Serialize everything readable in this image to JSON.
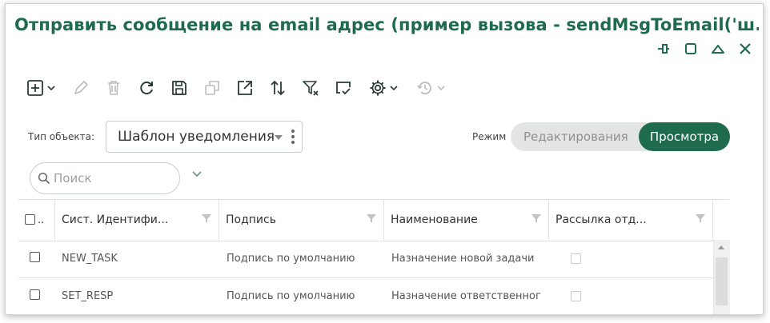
{
  "window": {
    "title": "Отправить сообщение на email адрес (пример вызова - sendMsgToEmail('ш...",
    "controls": [
      "pin-icon",
      "maximize-icon",
      "collapse-icon",
      "close-icon"
    ]
  },
  "toolbar": {
    "buttons": [
      "add-icon",
      "edit-icon",
      "delete-icon",
      "refresh-icon",
      "save-icon",
      "copy-icon",
      "open-external-icon",
      "sort-icon",
      "clear-filter-icon",
      "export-icon",
      "settings-icon",
      "history-icon"
    ]
  },
  "filter": {
    "object_type_label": "Тип объекта:",
    "object_type_value": "Шаблон уведомления",
    "mode_label": "Режим",
    "mode_edit": "Редактирования",
    "mode_view": "Просмотра",
    "active_mode": "Просмотра"
  },
  "search": {
    "placeholder": "Поиск",
    "value": ""
  },
  "table": {
    "columns": [
      {
        "label": "Сист. Идентифи..."
      },
      {
        "label": "Подпись"
      },
      {
        "label": "Наименование"
      },
      {
        "label": "Рассылка отд..."
      }
    ],
    "rows": [
      {
        "id": "NEW_TASK",
        "signature": "Подпись по умолчанию",
        "name": "Назначение новой задачи",
        "mailing": false
      },
      {
        "id": "SET_RESP",
        "signature": "Подпись по умолчанию",
        "name": "Назначение ответственног",
        "mailing": false
      }
    ]
  },
  "colors": {
    "accent": "#1e6b4e",
    "toggle_bg": "#e3e5e4"
  }
}
